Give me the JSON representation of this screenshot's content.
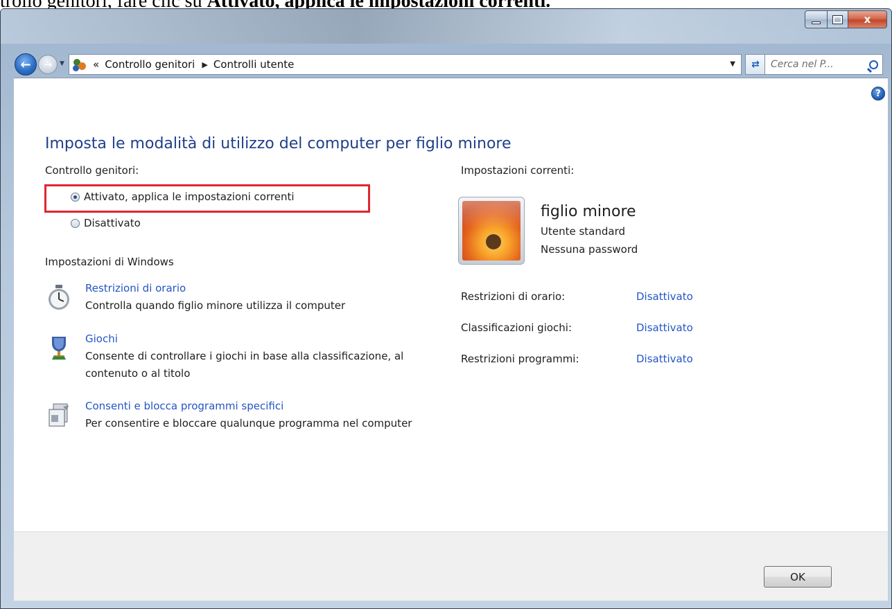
{
  "document_caption": {
    "prefix": "ntrollo genitori, fare clic su ",
    "bold": "Attivato, applica le impostazioni correnti",
    "suffix": "."
  },
  "window": {
    "close_glyph": "x"
  },
  "navigation": {
    "breadcrumb_prefix": "«",
    "breadcrumbs": [
      "Controllo genitori",
      "Controlli utente"
    ],
    "search_placeholder": "Cerca nel P..."
  },
  "page": {
    "title": "Imposta le modalità di utilizzo del computer per figlio minore",
    "parental_control_label": "Controllo genitori:",
    "options": [
      {
        "label": "Attivato, applica le impostazioni correnti",
        "checked": true
      },
      {
        "label": "Disattivato",
        "checked": false
      }
    ],
    "windows_settings_label": "Impostazioni di Windows",
    "settings": [
      {
        "icon": "stopwatch-icon",
        "link": "Restrizioni di orario",
        "description": "Controlla quando figlio minore utilizza il computer"
      },
      {
        "icon": "trophy-icon",
        "link": "Giochi",
        "description": "Consente di controllare i giochi in base alla classificazione, al contenuto o al titolo"
      },
      {
        "icon": "program-icon",
        "link": "Consenti e blocca programmi specifici",
        "description": "Per consentire e bloccare qualunque programma nel computer"
      }
    ]
  },
  "current_settings": {
    "label": "Impostazioni correnti:",
    "user_name": "figlio minore",
    "account_type": "Utente standard",
    "password_status": "Nessuna password",
    "rows": [
      {
        "label": "Restrizioni di orario:",
        "value": "Disattivato"
      },
      {
        "label": "Classificazioni giochi:",
        "value": "Disattivato"
      },
      {
        "label": "Restrizioni programmi:",
        "value": "Disattivato"
      }
    ]
  },
  "footer": {
    "ok_label": "OK"
  },
  "colors": {
    "link": "#2455c4",
    "title": "#1e3f8a",
    "highlight": "#e0252f"
  }
}
